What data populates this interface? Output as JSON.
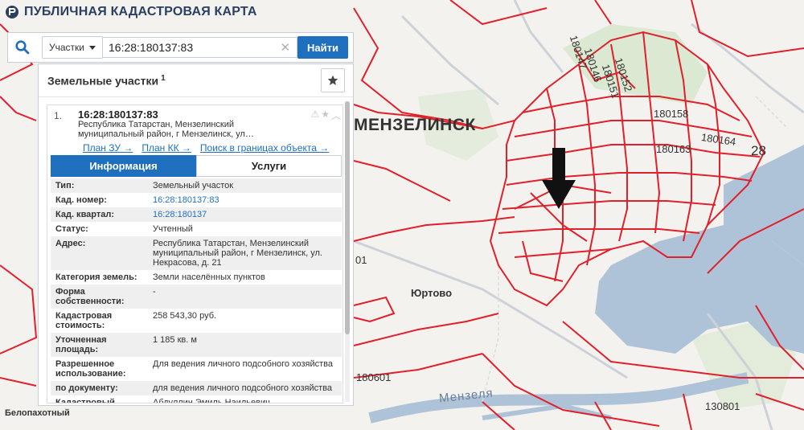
{
  "app": {
    "title": "ПУБЛИЧНАЯ КАДАСТРОВАЯ КАРТА"
  },
  "search": {
    "type_label": "Участки",
    "value": "16:28:180137:83",
    "find_label": "Найти"
  },
  "panel": {
    "title": "Земельные участки",
    "count": "1"
  },
  "result": {
    "number": "1.",
    "cad_number": "16:28:180137:83",
    "address_short": "Республика Татарстан, Мензелинский муниципальный район, г Мензелинск, ул…",
    "links": [
      "План ЗУ →",
      "План КК →",
      "Поиск в границах объекта →"
    ],
    "tabs": [
      "Информация",
      "Услуги"
    ]
  },
  "info_rows": [
    {
      "key": "Тип:",
      "value": "Земельный участок",
      "link": false
    },
    {
      "key": "Кад. номер:",
      "value": "16:28:180137:83",
      "link": true
    },
    {
      "key": "Кад. квартал:",
      "value": "16:28:180137",
      "link": true
    },
    {
      "key": "Статус:",
      "value": "Учтенный",
      "link": false
    },
    {
      "key": "Адрес:",
      "value": "Республика Татарстан, Мензелинский муниципальный район, г Мензелинск, ул. Некрасова, д. 21",
      "link": false
    },
    {
      "key": "Категория земель:",
      "value": "Земли населённых пунктов",
      "link": false
    },
    {
      "key": "Форма собственности:",
      "value": "-",
      "link": false
    },
    {
      "key": "Кадастровая стоимость:",
      "value": "258 543,30 руб.",
      "link": false
    },
    {
      "key": "Уточненная площадь:",
      "value": "1 185 кв. м",
      "link": false
    },
    {
      "key": "Разрешенное использование:",
      "value": "Для ведения личного подсобного хозяйства",
      "link": false
    },
    {
      "key": "по документу:",
      "value": "для ведения личного подсобного хозяйства",
      "link": false
    },
    {
      "key": "Кадастровый инженер:",
      "value": "Абдуллин Эмиль Наильевич",
      "link": false
    }
  ],
  "map": {
    "city": "МЕНЗЕЛИНСК",
    "village": "Юртово",
    "village2": "Белопахотный",
    "river": "Мензеля",
    "quarters": [
      "180147",
      "180146",
      "180151",
      "180152",
      "180158",
      "180163",
      "180164",
      "28",
      "180601",
      "130801",
      "01"
    ]
  },
  "colors": {
    "accent": "#1f6fbf",
    "boundary": "#e0202a",
    "water": "#aec3d8"
  }
}
